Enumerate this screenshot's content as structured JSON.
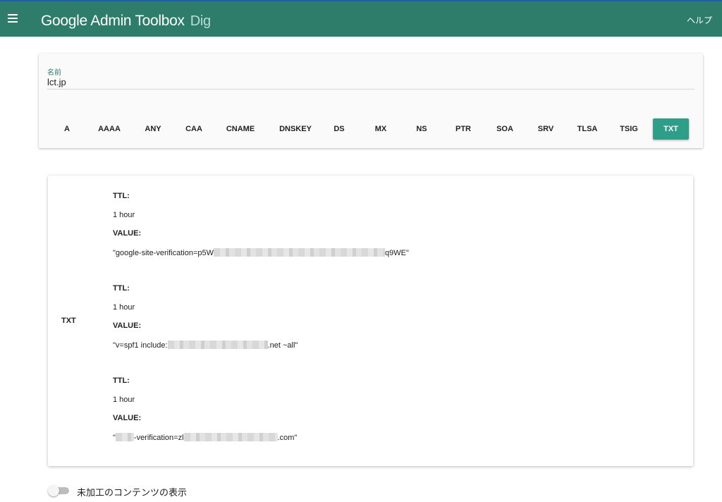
{
  "header": {
    "title": "Google Admin Toolbox",
    "subtitle": "Dig",
    "help_label": "ヘルプ",
    "menu_icon": "menu-icon"
  },
  "query": {
    "name_label": "名前",
    "name_value": "lct.jp"
  },
  "record_types": [
    {
      "label": "A",
      "active": false
    },
    {
      "label": "AAAA",
      "active": false
    },
    {
      "label": "ANY",
      "active": false
    },
    {
      "label": "CAA",
      "active": false
    },
    {
      "label": "CNAME",
      "active": false
    },
    {
      "label": "DNSKEY",
      "active": false
    },
    {
      "label": "DS",
      "active": false
    },
    {
      "label": "MX",
      "active": false
    },
    {
      "label": "NS",
      "active": false
    },
    {
      "label": "PTR",
      "active": false
    },
    {
      "label": "SOA",
      "active": false
    },
    {
      "label": "SRV",
      "active": false
    },
    {
      "label": "TLSA",
      "active": false
    },
    {
      "label": "TSIG",
      "active": false
    },
    {
      "label": "TXT",
      "active": true
    }
  ],
  "result": {
    "type": "TXT",
    "records": [
      {
        "ttl_label": "TTL:",
        "ttl": "1 hour",
        "value_label": "VALUE:",
        "value_prefix": "\"google-site-verification=p5W",
        "value_suffix": "q9WE\""
      },
      {
        "ttl_label": "TTL:",
        "ttl": "1 hour",
        "value_label": "VALUE:",
        "value_prefix": "\"v=spf1 include:",
        "value_suffix": ".net ~all\""
      },
      {
        "ttl_label": "TTL:",
        "ttl": "1 hour",
        "value_label": "VALUE:",
        "value_prefix": "\"",
        "value_middle": "-verification=zl",
        "value_suffix": ".com\""
      }
    ]
  },
  "raw_toggle": {
    "label": "未加工のコンテンツの表示",
    "enabled": false
  },
  "colors": {
    "appbar": "#2e7d6b",
    "accent": "#2e9e88"
  }
}
